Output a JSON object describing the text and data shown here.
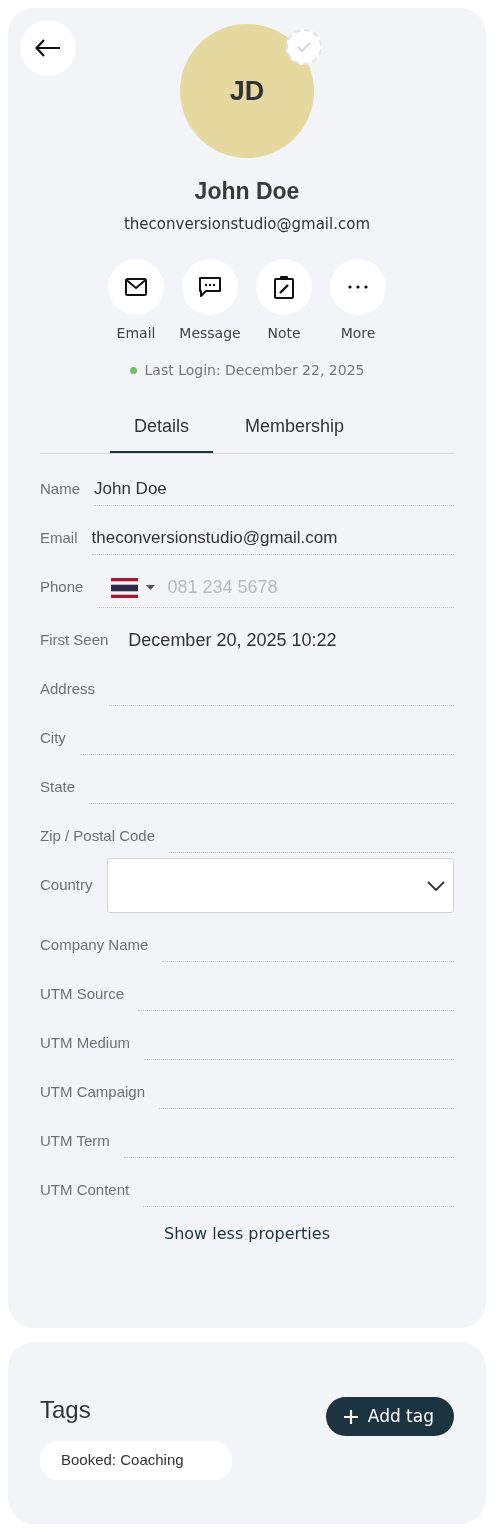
{
  "profile": {
    "initials": "JD",
    "name": "John Doe",
    "email": "theconversionstudio@gmail.com",
    "online": true,
    "last_login": "Last Login: December 22, 2025"
  },
  "actions": [
    {
      "kind": "email",
      "label": "Email"
    },
    {
      "kind": "message",
      "label": "Message"
    },
    {
      "kind": "note",
      "label": "Note"
    },
    {
      "kind": "more",
      "label": "More"
    }
  ],
  "tabs": [
    {
      "label": "Details",
      "selected": true
    },
    {
      "label": "Membership",
      "selected": false
    }
  ],
  "fields": [
    {
      "kind": "text",
      "label": "Name",
      "value": "John Doe"
    },
    {
      "kind": "text",
      "label": "Email",
      "value": "theconversionstudio@gmail.com"
    },
    {
      "kind": "phone",
      "label": "Phone",
      "placeholder": "081 234 5678"
    },
    {
      "kind": "static",
      "label": "First Seen",
      "value": "December 20, 2025 10:22"
    },
    {
      "kind": "text",
      "label": "Address"
    },
    {
      "kind": "text",
      "label": "City"
    },
    {
      "kind": "text",
      "label": "State"
    },
    {
      "kind": "text",
      "label": "Zip / Postal Code"
    },
    {
      "kind": "select",
      "label": "Country"
    },
    {
      "kind": "text",
      "label": "Company Name"
    },
    {
      "kind": "text",
      "label": "UTM Source"
    },
    {
      "kind": "text",
      "label": "UTM Medium"
    },
    {
      "kind": "text",
      "label": "UTM Campaign"
    },
    {
      "kind": "text",
      "label": "UTM Term"
    },
    {
      "kind": "text",
      "label": "UTM Content"
    }
  ],
  "toggle_link": "Show less properties",
  "tags": {
    "title": "Tags",
    "add_button": "Add tag",
    "items": [
      "Booked: Coaching"
    ]
  }
}
